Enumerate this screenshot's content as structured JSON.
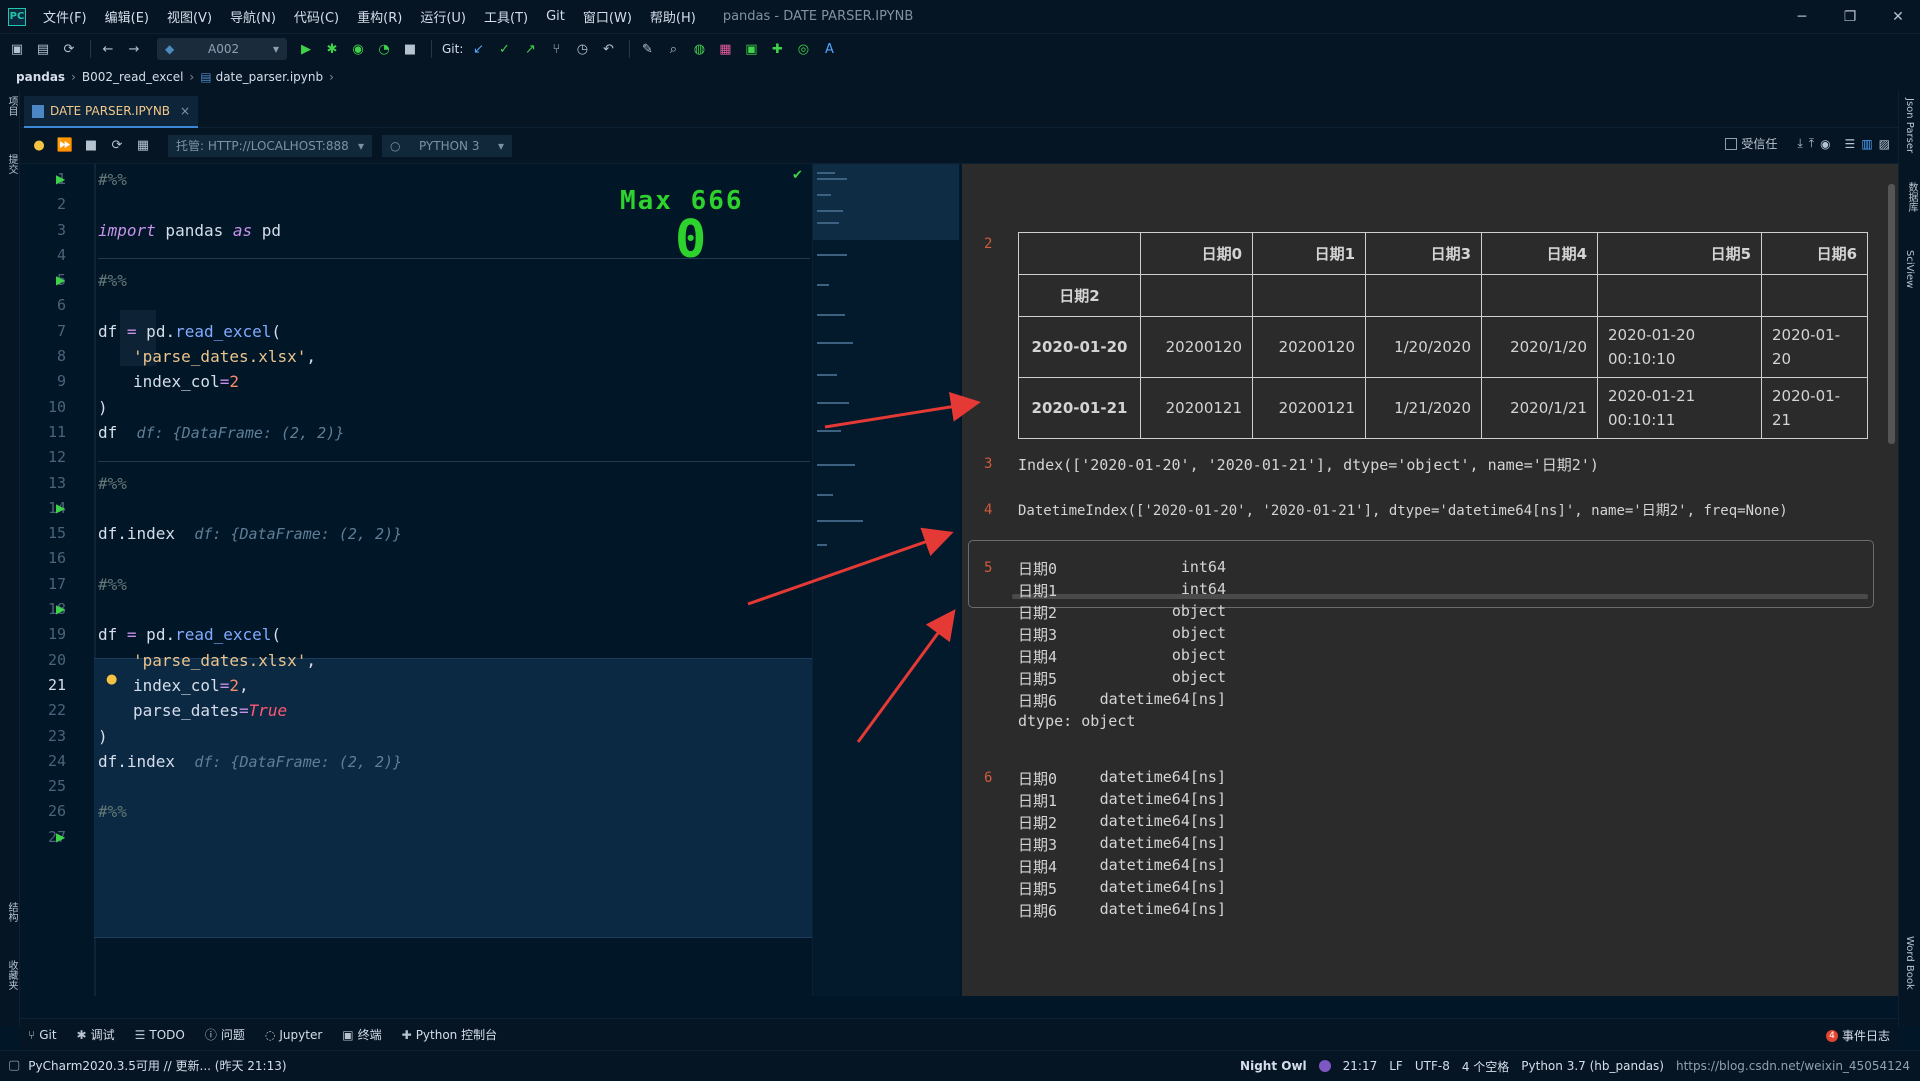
{
  "menubar": {
    "logo": "PC",
    "items": [
      "文件(F)",
      "编辑(E)",
      "视图(V)",
      "导航(N)",
      "代码(C)",
      "重构(R)",
      "运行(U)",
      "工具(T)",
      "Git",
      "窗口(W)",
      "帮助(H)"
    ],
    "title": "pandas - DATE PARSER.IPYNB"
  },
  "toolbar": {
    "run_config": "A002",
    "git_label": "Git:"
  },
  "breadcrumb": {
    "items": [
      "pandas",
      "B002_read_excel",
      "date_parser.ipynb"
    ]
  },
  "left_strip": {
    "labels": [
      "项目",
      "提交",
      "结构",
      "收藏夹"
    ]
  },
  "right_strip": {
    "labels": [
      "Json Parser",
      "数据库",
      "SciView",
      "Word Book"
    ]
  },
  "tab": {
    "label": "DATE PARSER.IPYNB",
    "close": "×"
  },
  "nb_toolbar": {
    "kernel_host": "托管: HTTP://LOCALHOST:888",
    "kernel_name": "PYTHON 3",
    "trusted_label": "受信任"
  },
  "editor": {
    "line_numbers": [
      "1",
      "2",
      "3",
      "4",
      "5",
      "6",
      "7",
      "8",
      "9",
      "10",
      "11",
      "12",
      "13",
      "14",
      "15",
      "16",
      "17",
      "18",
      "19",
      "20",
      "21",
      "22",
      "23",
      "24",
      "25",
      "26",
      "27"
    ],
    "active_line": "21",
    "overlay_max": "Max 666",
    "overlay_count": "0",
    "lines": {
      "l1": "#%%",
      "l3_kw": "import",
      "l3_mod": " pandas ",
      "l3_as": "as",
      "l3_alias": " pd",
      "l5": "#%%",
      "l7_a": "df ",
      "l7_eq": "=",
      "l7_b": " pd.",
      "l7_fn": "read_excel",
      "l7_c": "(",
      "l8": "'parse_dates.xlsx'",
      "l8_comma": ",",
      "l9_a": "index_col",
      "l9_eq": "=",
      "l9_v": "2",
      "l10": ")",
      "l11": "df",
      "l11_hint": "df: {DataFrame: (2, 2)}",
      "l13": "#%%",
      "l15": "df.index",
      "l15_hint": "df: {DataFrame: (2, 2)}",
      "l17": "#%%",
      "l19_a": "df ",
      "l19_eq": "=",
      "l19_b": " pd.",
      "l19_fn": "read_excel",
      "l19_c": "(",
      "l20": "'parse_dates.xlsx'",
      "l20_comma": ",",
      "l21_a": "index_col",
      "l21_eq": "=",
      "l21_v": "2",
      "l21_comma": ",",
      "l22_a": "parse_dates",
      "l22_eq": "=",
      "l22_v": "True",
      "l23": ")",
      "l24": "df.index",
      "l24_hint": "df: {DataFrame: (2, 2)}",
      "l26": "#%%"
    }
  },
  "output": {
    "indices": [
      "2",
      "3",
      "4",
      "5",
      "6"
    ],
    "table": {
      "columns": [
        "日期0",
        "日期1",
        "日期3",
        "日期4",
        "日期5",
        "日期6"
      ],
      "index_name": "日期2",
      "rows": [
        {
          "index": "2020-01-20",
          "cells": [
            "20200120",
            "20200120",
            "1/20/2020",
            "2020/1/20",
            "2020-01-20 00:10:10",
            "2020-01-20"
          ]
        },
        {
          "index": "2020-01-21",
          "cells": [
            "20200121",
            "20200121",
            "1/21/2020",
            "2020/1/21",
            "2020-01-21 00:10:11",
            "2020-01-21"
          ]
        }
      ]
    },
    "out3": "Index(['2020-01-20', '2020-01-21'], dtype='object', name='日期2')",
    "out4": "DatetimeIndex(['2020-01-20', '2020-01-21'], dtype='datetime64[ns]', name='日期2', freq=None)",
    "out5": [
      {
        "name": "日期0",
        "dtype": "int64"
      },
      {
        "name": "日期1",
        "dtype": "int64"
      },
      {
        "name": "日期2",
        "dtype": "object"
      },
      {
        "name": "日期3",
        "dtype": "object"
      },
      {
        "name": "日期4",
        "dtype": "object"
      },
      {
        "name": "日期5",
        "dtype": "object"
      },
      {
        "name": "日期6",
        "dtype": "datetime64[ns]"
      }
    ],
    "out5_footer": "dtype: object",
    "out6": [
      {
        "name": "日期0",
        "dtype": "datetime64[ns]"
      },
      {
        "name": "日期1",
        "dtype": "datetime64[ns]"
      },
      {
        "name": "日期2",
        "dtype": "datetime64[ns]"
      },
      {
        "name": "日期3",
        "dtype": "datetime64[ns]"
      },
      {
        "name": "日期4",
        "dtype": "datetime64[ns]"
      },
      {
        "name": "日期5",
        "dtype": "datetime64[ns]"
      },
      {
        "name": "日期6",
        "dtype": "datetime64[ns]"
      }
    ]
  },
  "bottom_tabs": [
    "Git",
    "调试",
    "TODO",
    "问题",
    "Jupyter",
    "终端",
    "Python 控制台"
  ],
  "event_log": {
    "count": "4",
    "label": "事件日志"
  },
  "statusbar": {
    "left": "PyCharm2020.3.5可用 // 更新... (昨天 21:13)",
    "theme": "Night Owl",
    "position": "21:17",
    "line_sep": "LF",
    "encoding": "UTF-8",
    "indent": "4 个空格",
    "interpreter": "Python 3.7 (hb_pandas)",
    "watermark": "https://blog.csdn.net/weixin_45054124",
    "accent": "#7e57c2"
  },
  "icons": [
    "search-icon",
    "run-icon",
    "debug-icon",
    "stop-icon",
    "refresh-icon",
    "bulb-icon",
    "close-icon",
    "arrow-icon"
  ]
}
